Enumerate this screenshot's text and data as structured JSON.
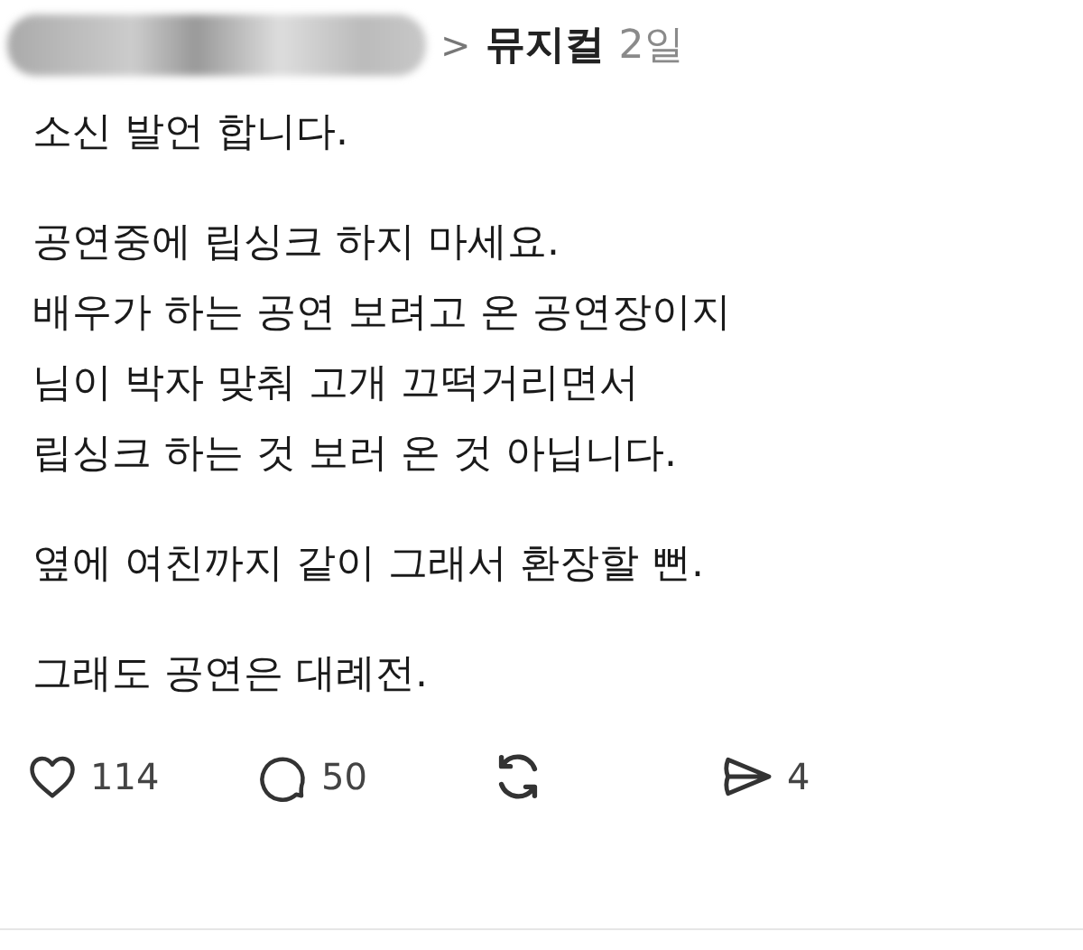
{
  "post": {
    "header": {
      "separator": ">",
      "topic": "뮤지컬",
      "time": "2일"
    },
    "paragraphs": [
      [
        "소신 발언 합니다."
      ],
      [
        "공연중에 립싱크 하지 마세요.",
        "배우가 하는 공연 보려고 온 공연장이지",
        "님이 박자 맞춰 고개 끄떡거리면서",
        "립싱크 하는 것 보러 온 것 아닙니다."
      ],
      [
        "옆에 여친까지 같이 그래서 환장할 뻔."
      ],
      [
        "그래도 공연은 대례전."
      ]
    ],
    "actions": [
      {
        "kind": "like",
        "count": "114"
      },
      {
        "kind": "reply",
        "count": "50"
      },
      {
        "kind": "repost"
      },
      {
        "kind": "share",
        "count": "4"
      }
    ]
  }
}
